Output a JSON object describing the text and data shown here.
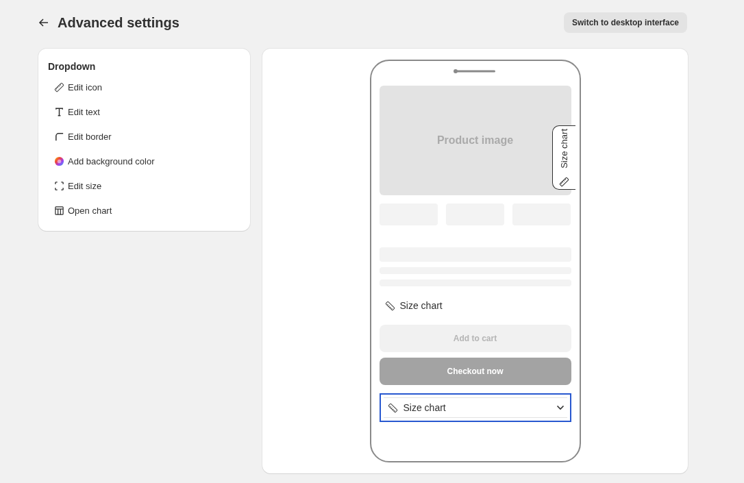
{
  "header": {
    "title": "Advanced settings",
    "button": "Switch to desktop interface"
  },
  "menu": {
    "title": "Dropdown",
    "items": [
      {
        "kind": "ruler",
        "label": "Edit icon"
      },
      {
        "kind": "text",
        "label": "Edit text"
      },
      {
        "kind": "border",
        "label": "Edit border"
      },
      {
        "kind": "color",
        "label": "Add background color"
      },
      {
        "kind": "size",
        "label": "Edit size"
      },
      {
        "kind": "table",
        "label": "Open chart"
      }
    ]
  },
  "preview": {
    "product_image": "Product image",
    "side_tab": "Size chart",
    "inline_link": "Size chart",
    "add_to_cart": "Add to cart",
    "checkout": "Checkout now",
    "dropdown": {
      "label": "Size chart",
      "selected": true
    }
  }
}
